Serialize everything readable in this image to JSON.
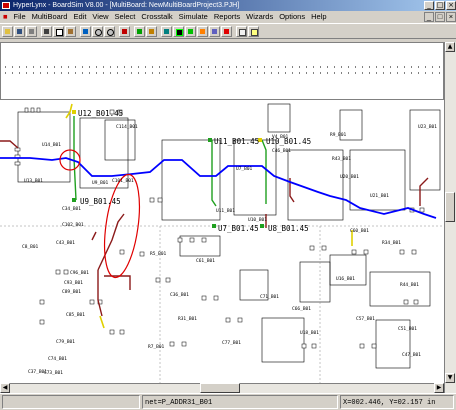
{
  "window": {
    "title": "HyperLynx - BoardSim V8.00 - [MultiBoard: NewMultiBoardProject3.PJH]"
  },
  "menu": [
    "File",
    "MultiBoard",
    "Edit",
    "View",
    "Select",
    "Crosstalk",
    "Simulate",
    "Reports",
    "Wizards",
    "Options",
    "Help"
  ],
  "nets": {
    "highlight_color": "#0000ff",
    "ref_labels": [
      {
        "id": "u12",
        "text": "U12_B01.45"
      },
      {
        "id": "u9",
        "text": "U9_B01.45"
      },
      {
        "id": "u11",
        "text": "U11_B01.45"
      },
      {
        "id": "u10",
        "text": "U10_B01.45"
      },
      {
        "id": "u7",
        "text": "U7_B01.45"
      },
      {
        "id": "u8",
        "text": "U8_B01.45"
      }
    ],
    "component_labels": [
      "C114_B01",
      "U14_B01",
      "U13_B01",
      "C34_B01",
      "U9_B01",
      "C101_B01",
      "C96_B01",
      "C93_B01",
      "C89_B01",
      "C85_B01",
      "C79_B01",
      "C74_B01",
      "C73_B01",
      "C37_B01",
      "R5_B01",
      "C102_B01",
      "U7_B01",
      "U11_B01",
      "R9_B01",
      "R43_B01",
      "U20_B01",
      "C60_B01",
      "R34_B01",
      "U21_B01",
      "R44_B01",
      "U23_B01",
      "V4_B01",
      "U10_B01",
      "C46_B01",
      "U16_B01",
      "U18_B01",
      "C8_B01",
      "C43_B01",
      "R7_B01",
      "C61_B01",
      "C36_B01",
      "R31_B01",
      "C77_B01",
      "C71_B01",
      "C66_B01",
      "C57_B01",
      "C51_B01",
      "C47_B01"
    ]
  },
  "status": {
    "net_label": "net=P_ADDR31_B01",
    "coords": "X=002.446, Y=02.157 in"
  },
  "tools": [
    "open-icon",
    "save-icon",
    "print-icon",
    "cut-icon",
    "copy-icon",
    "paste-icon",
    "undo-icon",
    "zoom-in-icon",
    "zoom-out-icon",
    "zoom-fit-icon",
    "select-net-icon",
    "stackup-icon",
    "terminator-wizard-icon",
    "oscilloscope-icon",
    "sweep-icon",
    "crosstalk-icon",
    "em-icon",
    "stop-icon",
    "report-icon",
    "help-icon"
  ]
}
